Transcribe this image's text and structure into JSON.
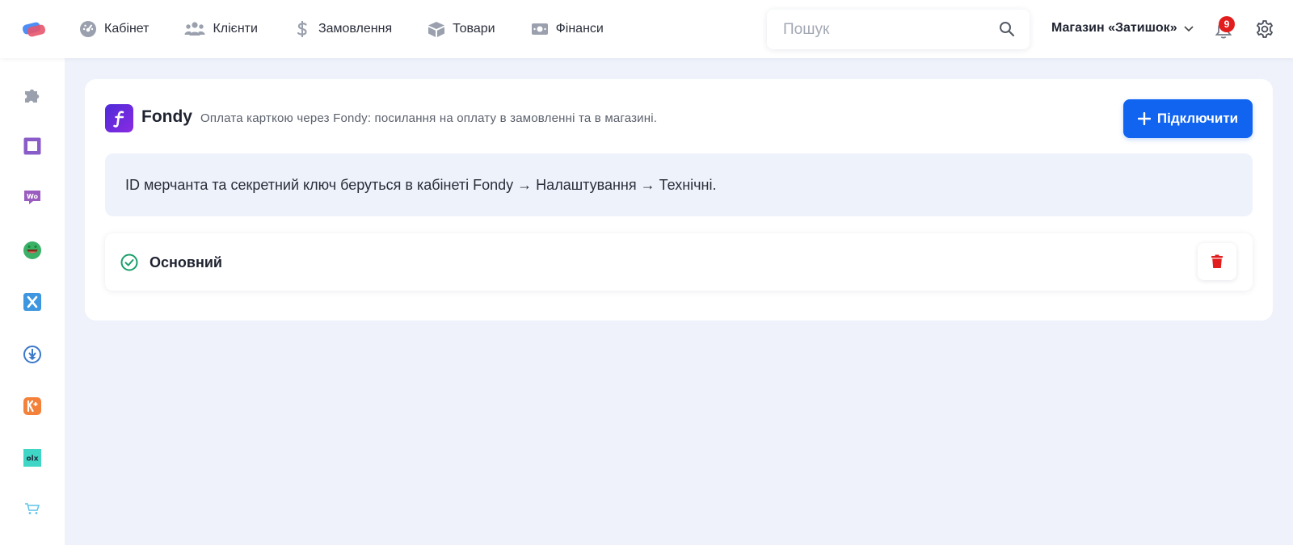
{
  "nav": {
    "items": [
      {
        "label": "Кабінет",
        "icon": "dashboard-icon"
      },
      {
        "label": "Клієнти",
        "icon": "users-icon"
      },
      {
        "label": "Замовлення",
        "icon": "dollar-icon"
      },
      {
        "label": "Товари",
        "icon": "box-icon"
      },
      {
        "label": "Фінанси",
        "icon": "money-icon"
      }
    ]
  },
  "search": {
    "placeholder": "Пошук"
  },
  "store": {
    "label": "Магазин «Затишок»"
  },
  "notifications": {
    "count": "9"
  },
  "sidebar": {
    "items": [
      {
        "icon": "puzzle-icon"
      },
      {
        "icon": "square-frame-icon"
      },
      {
        "icon": "woocommerce-icon"
      },
      {
        "icon": "smiley-icon"
      },
      {
        "icon": "x-box-icon"
      },
      {
        "icon": "download-arrow-icon"
      },
      {
        "icon": "k-plus-icon"
      },
      {
        "icon": "olx-icon"
      },
      {
        "icon": "cart-icon"
      }
    ]
  },
  "integration": {
    "name": "Fondy",
    "description": "Оплата карткою через Fondy: посилання на оплату в замовленні та в магазині.",
    "connect_label": "Підключити",
    "info": "ID мерчанта та секретний ключ беруться в кабінеті Fondy → Налаштування → Технічні.",
    "account_name": "Основний"
  },
  "colors": {
    "accent": "#1064f0",
    "danger": "#e11d1d",
    "success": "#1a9e6a",
    "background": "#eff2fa"
  }
}
